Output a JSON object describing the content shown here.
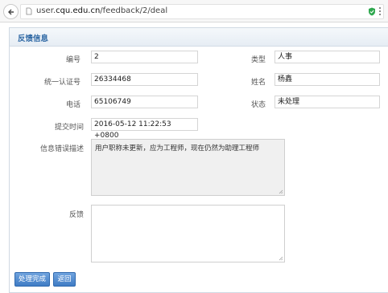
{
  "browser": {
    "url_prefix": "user.",
    "url_domain": "cqu.edu.cn",
    "url_path": "/feedback/2/deal"
  },
  "panel": {
    "title": "反馈信息"
  },
  "form": {
    "id_label": "编号",
    "id_value": "2",
    "type_label": "类型",
    "type_value": "人事",
    "uid_label": "统一认证号",
    "uid_value": "26334468",
    "name_label": "姓名",
    "name_value": "杨鑫",
    "phone_label": "电话",
    "phone_value": "65106749",
    "status_label": "状态",
    "status_value": "未处理",
    "time_label": "提交时间",
    "time_value": "2016-05-12 11:22:53 +0800",
    "desc_label": "信息错误描述",
    "desc_value": "用户职称未更新，应为工程师，现在仍然为助理工程师",
    "feedback_label": "反馈",
    "feedback_value": ""
  },
  "actions": {
    "done_label": "处理完成",
    "back_label": "返回"
  },
  "colors": {
    "accent": "#2c66a3",
    "button": "#4a86cc"
  }
}
